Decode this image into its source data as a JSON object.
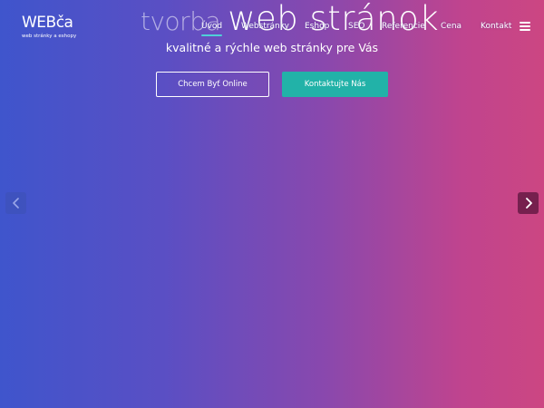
{
  "logo": {
    "main": "WEBča",
    "sub": "web stránky a eshopy"
  },
  "headline": {
    "part1": "tvorba",
    "part2": "web stránok"
  },
  "nav": {
    "items": [
      {
        "label": "Úvod",
        "active": true
      },
      {
        "label": "Webstránky",
        "active": false
      },
      {
        "label": "Eshop",
        "active": false
      },
      {
        "label": "SEO",
        "active": false
      },
      {
        "label": "Referencie",
        "active": false
      },
      {
        "label": "Cena",
        "active": false
      },
      {
        "label": "Kontakt",
        "active": false
      }
    ],
    "menu_icon": "hamburger-menu-icon"
  },
  "hero": {
    "subtitle": "kvalitné a rýchle web stránky pre Vás",
    "primary_button": "Chcem Byť Online",
    "secondary_button": "Kontaktujte Nás"
  },
  "slider": {
    "prev_icon": "chevron-left-icon",
    "next_icon": "chevron-right-icon"
  },
  "colors": {
    "gradient_start": "#3f55cc",
    "gradient_end": "#cc4682",
    "accent_button": "#22b2a8",
    "active_underline": "#4fd0d8"
  }
}
